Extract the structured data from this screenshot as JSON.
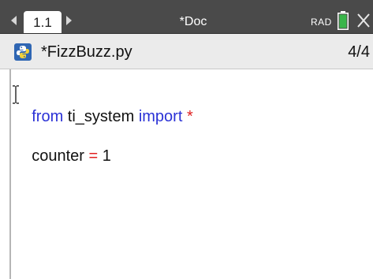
{
  "titlebar": {
    "tab_label": "1.1",
    "doc_title": "*Doc",
    "angle_mode": "RAD",
    "battery_color": "#39b54a"
  },
  "filebar": {
    "icon": "python-icon",
    "filename": "*FizzBuzz.py",
    "page_count": "4/4"
  },
  "editor": {
    "lines": [
      {
        "tokens": [
          {
            "text": "from",
            "kind": "keyword"
          },
          {
            "text": " ti_system ",
            "kind": "plain"
          },
          {
            "text": "import",
            "kind": "keyword"
          },
          {
            "text": " ",
            "kind": "plain"
          },
          {
            "text": "*",
            "kind": "operator"
          }
        ]
      },
      {
        "tokens": [
          {
            "text": "counter ",
            "kind": "plain"
          },
          {
            "text": "=",
            "kind": "operator"
          },
          {
            "text": " 1",
            "kind": "plain"
          }
        ]
      }
    ]
  },
  "colors": {
    "keyword": "#2b32d6",
    "operator": "#e02020",
    "titlebar_bg": "#4a4a4a"
  }
}
